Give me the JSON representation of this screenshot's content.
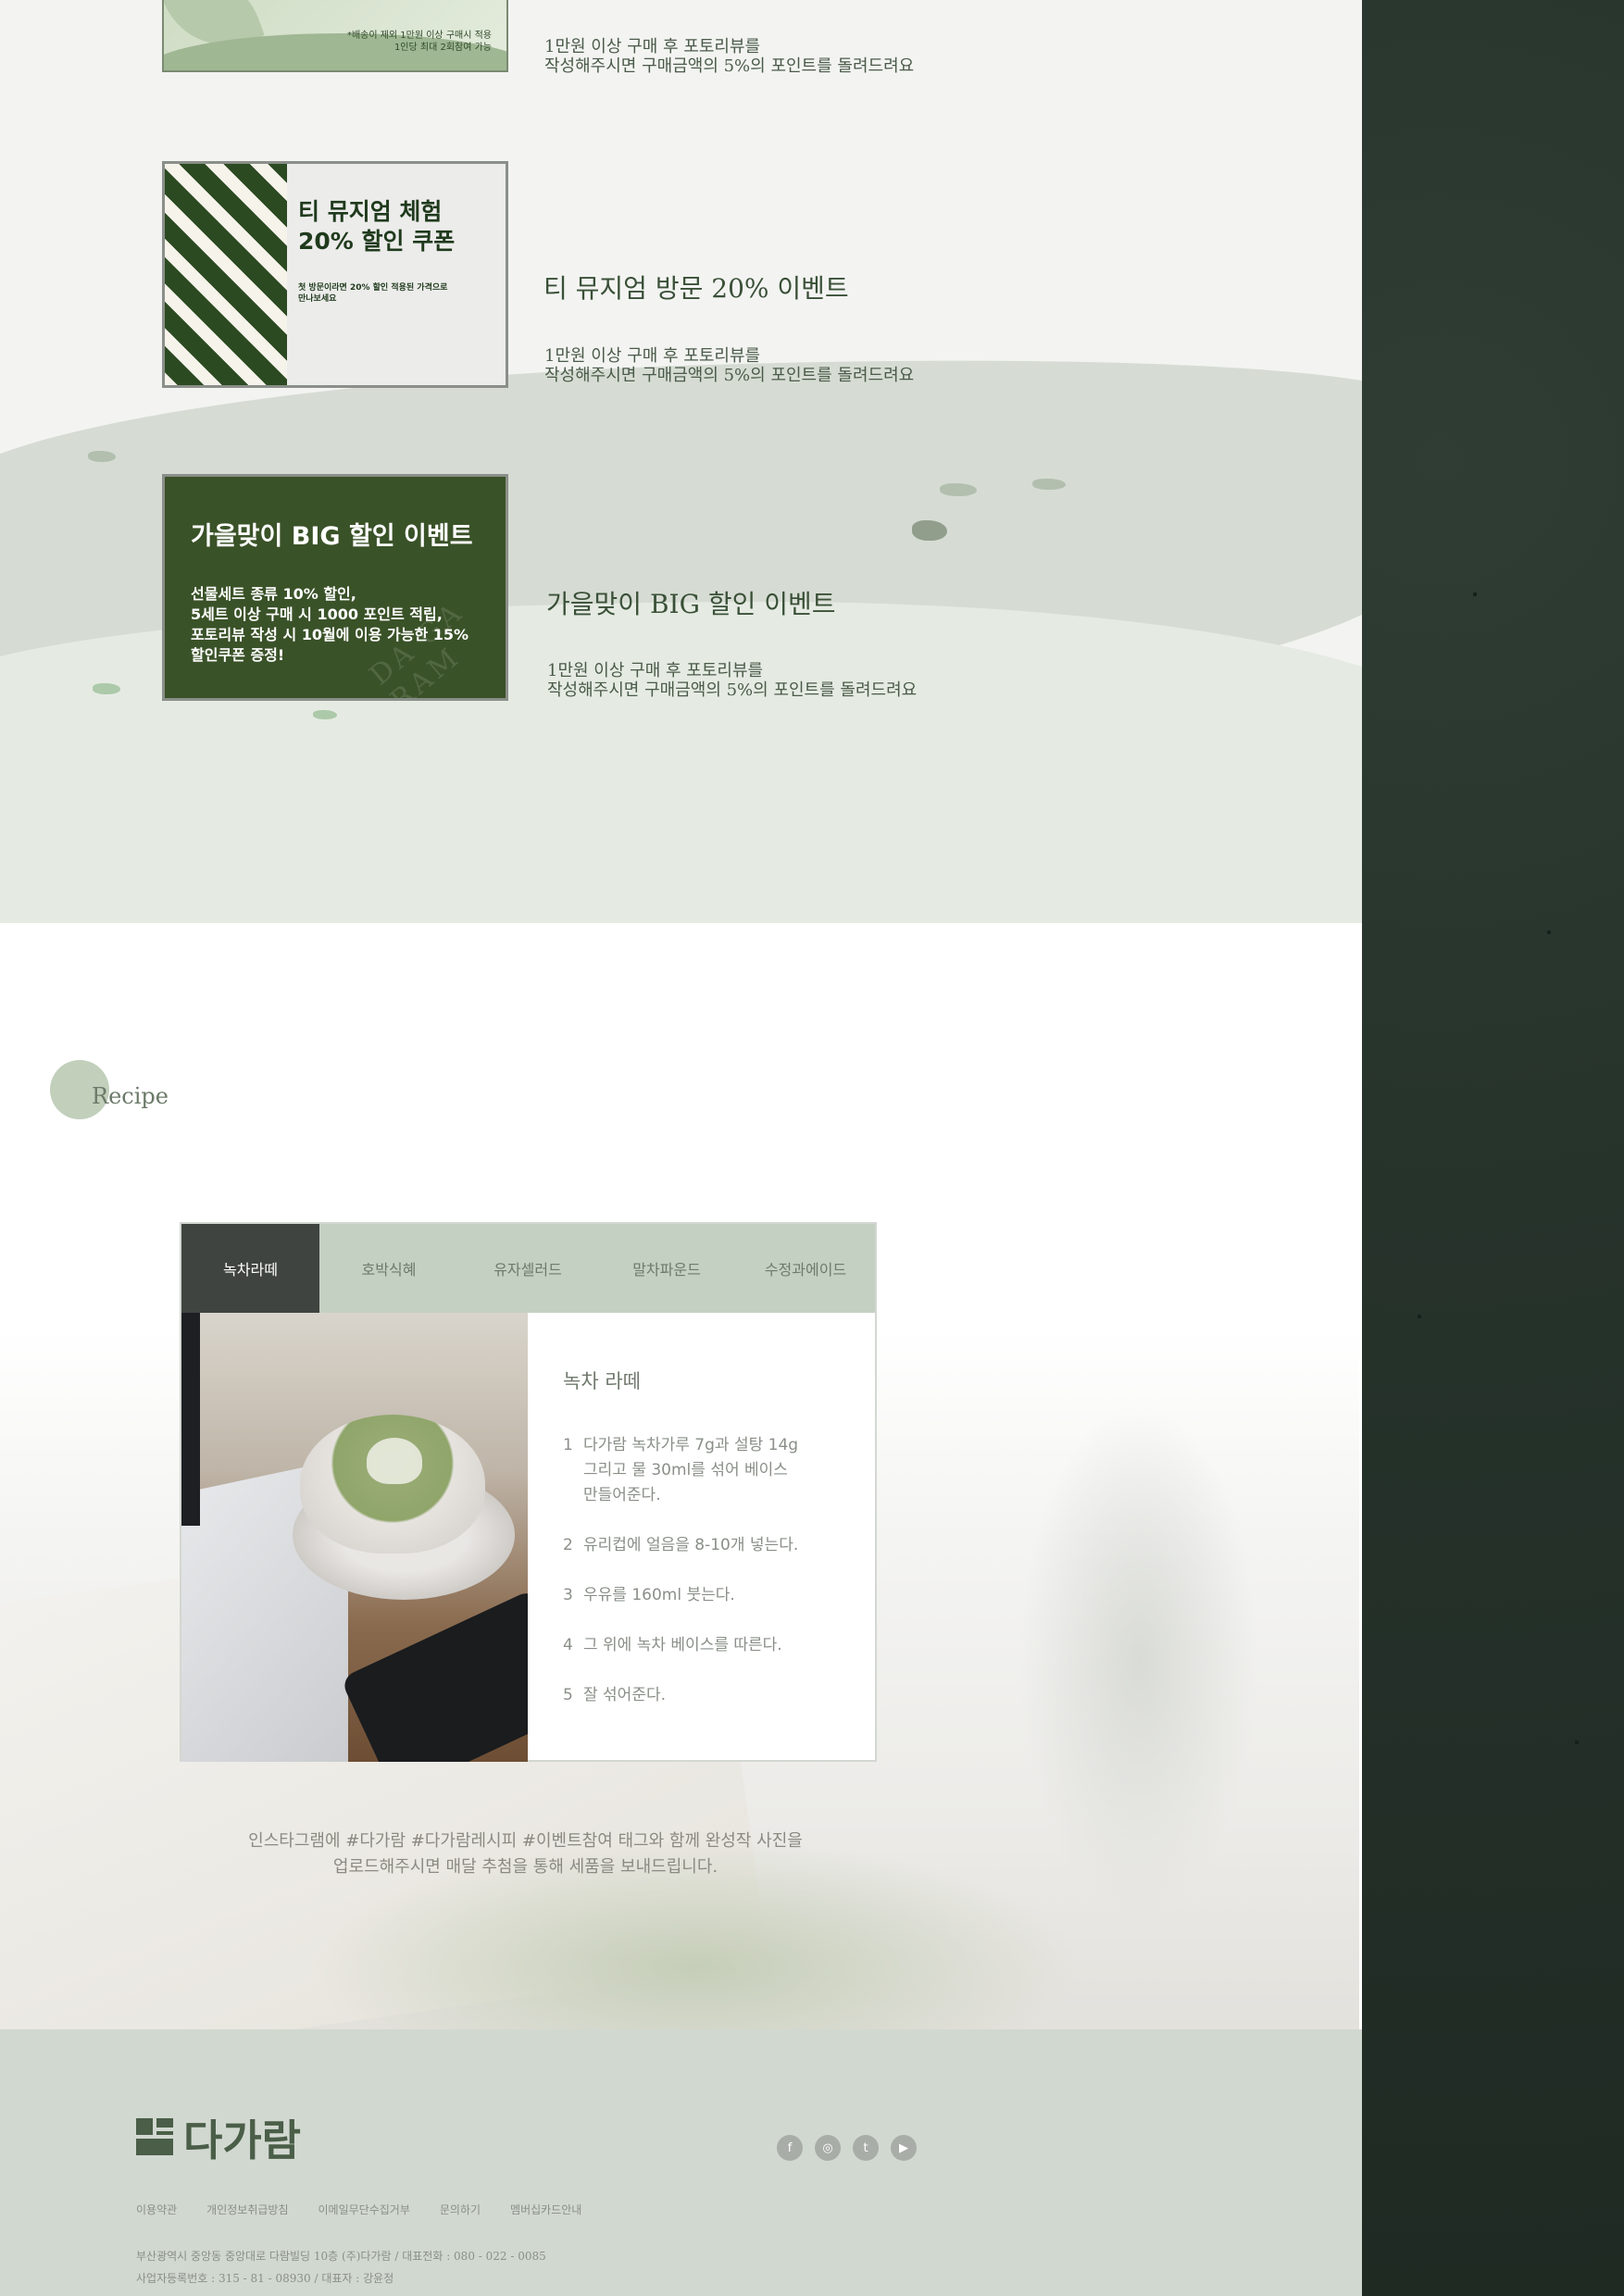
{
  "events": {
    "items": [
      {
        "card_note": "*배송이 제외 1만원 이상 구매시 적용\n1인당 최대 2회참여 가능",
        "title": "",
        "desc": "1만원 이상 구매 후 포토리뷰를\n작성해주시면 구매금액의 5%의 포인트를 돌려드려요"
      },
      {
        "card_heading": "티 뮤지엄 체험\n20% 할인 쿠폰",
        "card_sub": "첫 방문이라면 20% 할인 적용된 가격으로\n만나보세요",
        "title": "티 뮤지엄 방문 20% 이벤트",
        "desc": "1만원 이상 구매 후 포토리뷰를\n작성해주시면 구매금액의 5%의 포인트를 돌려드려요"
      },
      {
        "card_heading": "가을맞이 BIG 할인 이벤트",
        "card_sub": "선물세트 종류 10% 할인,\n5세트 이상 구매 시 1000 포인트 적립,\n포토리뷰 작성 시 10월에 이용 가능한 15%\n할인쿠폰 증정!",
        "watermark": "DA GA RAM",
        "title": "가을맞이 BIG 할인 이벤트",
        "desc": "1만원 이상 구매 후 포토리뷰를\n작성해주시면 구매금액의 5%의 포인트를 돌려드려요"
      }
    ]
  },
  "recipe": {
    "section_label": "Recipe",
    "tabs": [
      "녹차라떼",
      "호박식혜",
      "유자셀러드",
      "말차파운드",
      "수정과에이드"
    ],
    "active_tab": 0,
    "title": "녹차 라떼",
    "steps": [
      {
        "num": "1",
        "text": "다가람 녹차가루 7g과 설탕 14g\n그리고 물 30ml를 섞어 베이스\n만들어준다."
      },
      {
        "num": "2",
        "text": "유리컵에 얼음을 8-10개 넣는다."
      },
      {
        "num": "3",
        "text": "우유를 160ml 붓는다."
      },
      {
        "num": "4",
        "text": "그 위에 녹차 베이스를 따른다."
      },
      {
        "num": "5",
        "text": "잘 섞어준다."
      }
    ],
    "insta_note": "인스타그램에 #다가람 #다가람레시피 #이벤트참여 태그와 함께 완성작 사진을\n업로드해주시면 매달 추첨을 통해 세품을 보내드립니다."
  },
  "footer": {
    "brand": "다가람",
    "social_icons": [
      "facebook-icon",
      "instagram-icon",
      "twitter-icon",
      "youtube-icon"
    ],
    "social_glyphs": [
      "f",
      "◎",
      "t",
      "▶"
    ],
    "links": [
      "이용약관",
      "개인정보취급방침",
      "이메일무단수집거부",
      "문의하기",
      "멤버십카드안내"
    ],
    "info": "부산광역시 중앙동 중앙대로 다람빌딩 10층 (주)다가람 / 대표전화 : 080 - 022 - 0085\n사업자등록번호 : 315 - 81 - 08930 / 대표자 : 강윤정"
  },
  "colors": {
    "side_panel": "#26332b",
    "accent_green": "#3a5228",
    "tab_bg": "#c4d1c2",
    "tab_active": "#3f4440",
    "footer_bg": "#d1d8d0"
  }
}
